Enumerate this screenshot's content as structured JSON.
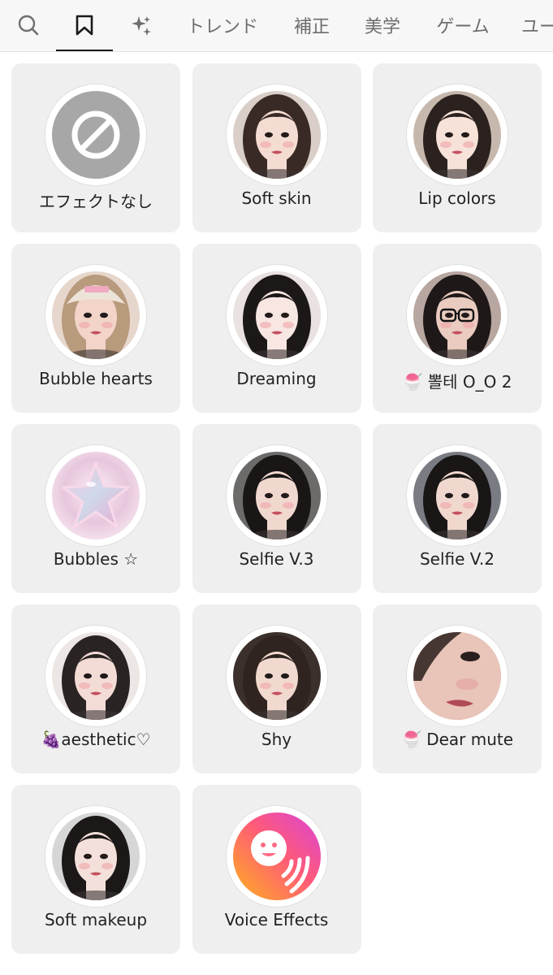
{
  "tabs": [
    {
      "id": "search",
      "icon": "search-icon",
      "label": ""
    },
    {
      "id": "saved",
      "icon": "bookmark-icon",
      "label": "",
      "active": true
    },
    {
      "id": "sparkle",
      "icon": "sparkle-icon",
      "label": ""
    },
    {
      "id": "trend",
      "label": "トレンド"
    },
    {
      "id": "correct",
      "label": "補正"
    },
    {
      "id": "aesthetic",
      "label": "美学"
    },
    {
      "id": "game",
      "label": "ゲーム"
    },
    {
      "id": "user",
      "label": "ユー"
    }
  ],
  "effects": [
    {
      "label": "エフェクトなし",
      "kind": "none",
      "icon": "no-effect-icon"
    },
    {
      "label": "Soft skin",
      "kind": "face",
      "hair": "#3a2a25",
      "bg": "#d9cfc8",
      "skin": "#f4dcd3"
    },
    {
      "label": "Lip colors",
      "kind": "face",
      "hair": "#2b211e",
      "bg": "#c7b8ae",
      "skin": "#f6e2d8"
    },
    {
      "label": "Bubble hearts",
      "kind": "face",
      "hair": "#b89a7c",
      "bg": "#e6d6cc",
      "skin": "#f2d5c8",
      "hat": "#ece4d8"
    },
    {
      "label": "Dreaming",
      "kind": "face",
      "hair": "#1d1818",
      "bg": "#e9e2e0",
      "skin": "#f7e6e2"
    },
    {
      "label": "🍧 뽈테 O_O 2",
      "kind": "face",
      "hair": "#1f1818",
      "bg": "#b8a7a0",
      "skin": "#e9cbbf",
      "glasses": true
    },
    {
      "label": "Bubbles ☆",
      "kind": "star",
      "icon": "star-bubble-icon"
    },
    {
      "label": "Selfie V.3",
      "kind": "face",
      "hair": "#1a1616",
      "bg": "#6d6a6a",
      "skin": "#f1d8cf"
    },
    {
      "label": "Selfie V.2",
      "kind": "face",
      "hair": "#1a1616",
      "bg": "#7a7c84",
      "skin": "#f1d8cf"
    },
    {
      "label": "🍇aesthetic♡",
      "kind": "face",
      "hair": "#2a2323",
      "bg": "#ece6e4",
      "skin": "#f3dcd6"
    },
    {
      "label": "Shy",
      "kind": "face",
      "hair": "#2f2420",
      "bg": "#3b302c",
      "skin": "#f2d9cf"
    },
    {
      "label": "🍧 Dear mute",
      "kind": "face",
      "hair": "#2a1e1a",
      "bg": "#c9aca2",
      "skin": "#e9c4b8",
      "closeup": true
    },
    {
      "label": "Soft makeup",
      "kind": "face",
      "hair": "#1c1818",
      "bg": "#d6d6d6",
      "skin": "#f3e0da"
    },
    {
      "label": "Voice Effects",
      "kind": "voice",
      "icon": "voice-effects-icon"
    }
  ]
}
